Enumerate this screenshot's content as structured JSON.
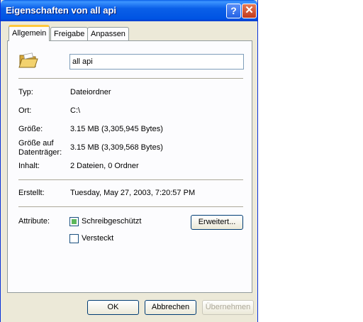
{
  "window": {
    "title": "Eigenschaften von all api",
    "help_glyph": "?",
    "close_glyph": "✕"
  },
  "tabs": [
    {
      "label": "Allgemein",
      "active": true
    },
    {
      "label": "Freigabe",
      "active": false
    },
    {
      "label": "Anpassen",
      "active": false
    }
  ],
  "general": {
    "name_value": "all api",
    "type_label": "Typ:",
    "type_value": "Dateiordner",
    "location_label": "Ort:",
    "location_value": "C:\\",
    "size_label": "Größe:",
    "size_value": "3.15 MB (3,305,945 Bytes)",
    "disk_size_label_1": "Größe auf",
    "disk_size_label_2": "Datenträger:",
    "disk_size_value": "3.15 MB (3,309,568 Bytes)",
    "contents_label": "Inhalt:",
    "contents_value": "2 Dateien, 0 Ordner",
    "created_label": "Erstellt:",
    "created_value": "Tuesday, May 27, 2003, 7:20:57 PM",
    "attributes_label": "Attribute:",
    "readonly_label": "Schreibgeschützt",
    "readonly_state": "indeterminate",
    "hidden_label": "Versteckt",
    "hidden_state": "unchecked",
    "advanced_button": "Erweitert..."
  },
  "footer": {
    "ok_button": "OK",
    "cancel_button": "Abbrechen",
    "apply_button": "Übernehmen"
  },
  "icons": {
    "folder": "folder-icon"
  }
}
